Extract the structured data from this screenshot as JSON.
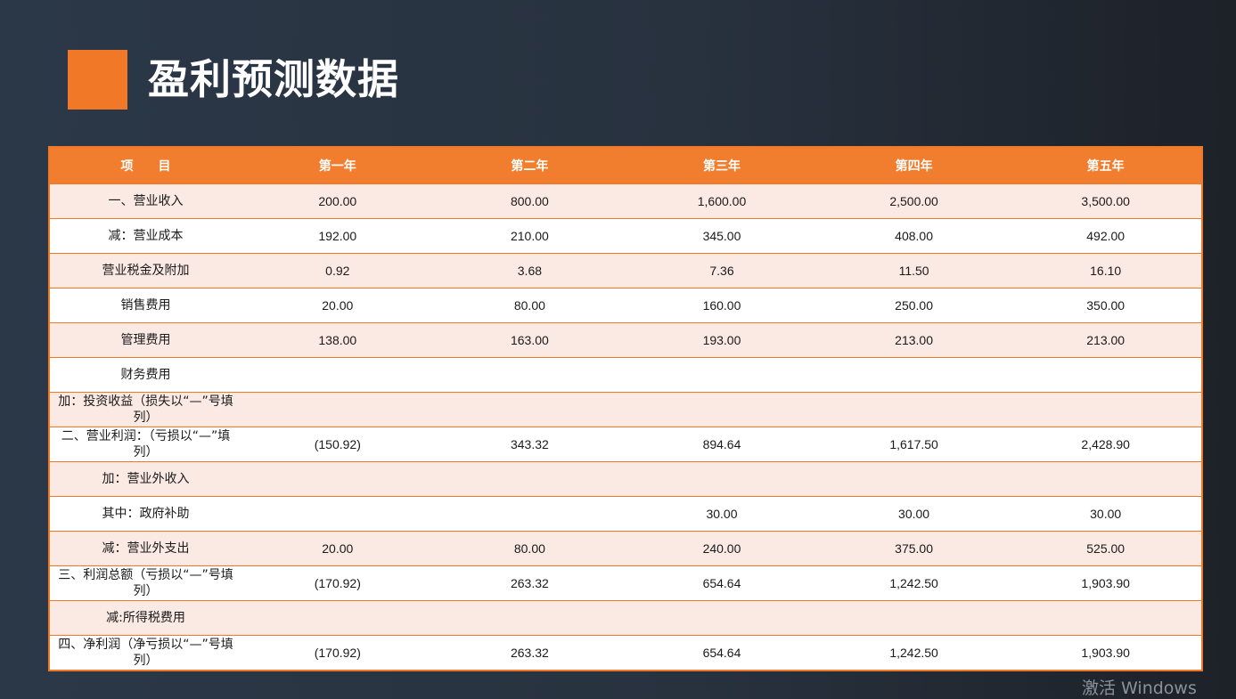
{
  "slide": {
    "title": "盈利预测数据"
  },
  "colors": {
    "accent": "#f07826",
    "header_bg": "#f07e2e",
    "row_alt": "#fbe9e4",
    "background": "#2b3848"
  },
  "table": {
    "headers": [
      "项　　目",
      "第一年",
      "第二年",
      "第三年",
      "第四年",
      "第五年"
    ],
    "rows": [
      {
        "item": "一、营业收入",
        "values": [
          "200.00",
          "800.00",
          "1,600.00",
          "2,500.00",
          "3,500.00"
        ]
      },
      {
        "item": "减：营业成本",
        "values": [
          "192.00",
          "210.00",
          "345.00",
          "408.00",
          "492.00"
        ]
      },
      {
        "item": "营业税金及附加",
        "values": [
          "0.92",
          "3.68",
          "7.36",
          "11.50",
          "16.10"
        ]
      },
      {
        "item": "销售费用",
        "values": [
          "20.00",
          "80.00",
          "160.00",
          "250.00",
          "350.00"
        ]
      },
      {
        "item": "管理费用",
        "values": [
          "138.00",
          "163.00",
          "193.00",
          "213.00",
          "213.00"
        ]
      },
      {
        "item": "财务费用",
        "values": [
          "",
          "",
          "",
          "",
          ""
        ]
      },
      {
        "item": "加：投资收益（损失以“—”号填列）",
        "values": [
          "",
          "",
          "",
          "",
          ""
        ]
      },
      {
        "item": "二、营业利润：（亏损以“—”填列）",
        "values": [
          "(150.92)",
          "343.32",
          "894.64",
          "1,617.50",
          "2,428.90"
        ]
      },
      {
        "item": "加：营业外收入",
        "values": [
          "",
          "",
          "",
          "",
          ""
        ]
      },
      {
        "item": "其中：政府补助",
        "values": [
          "",
          "",
          "30.00",
          "30.00",
          "30.00"
        ]
      },
      {
        "item": "减：营业外支出",
        "values": [
          "20.00",
          "80.00",
          "240.00",
          "375.00",
          "525.00"
        ]
      },
      {
        "item": "三、利润总额（亏损以“—”号填列）",
        "values": [
          "(170.92)",
          "263.32",
          "654.64",
          "1,242.50",
          "1,903.90"
        ]
      },
      {
        "item": "减:所得税费用",
        "values": [
          "",
          "",
          "",
          "",
          ""
        ]
      },
      {
        "item": "四、净利润（净亏损以“—”号填列）",
        "values": [
          "(170.92)",
          "263.32",
          "654.64",
          "1,242.50",
          "1,903.90"
        ]
      }
    ]
  },
  "watermark": {
    "text": "激活 Windows"
  }
}
